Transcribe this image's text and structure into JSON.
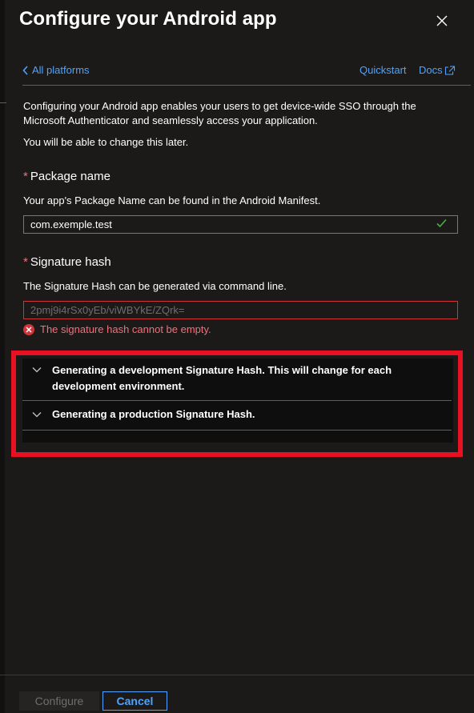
{
  "header": {
    "title": "Configure your Android app"
  },
  "nav": {
    "back_label": "All platforms",
    "quickstart_label": "Quickstart",
    "docs_label": "Docs"
  },
  "intro": {
    "line1": "Configuring your Android app enables your users to get device-wide SSO through the Microsoft Authenticator and seamlessly access your application.",
    "line2": "You will be able to change this later."
  },
  "package": {
    "required_mark": "*",
    "label": "Package name",
    "help": "Your app's Package Name can be found in the Android Manifest.",
    "value": "com.exemple.test"
  },
  "signature": {
    "required_mark": "*",
    "label": "Signature hash",
    "help": "The Signature Hash can be generated via command line.",
    "placeholder": "2pmj9i4rSx0yEb/viWBYkE/ZQrk=",
    "error": "The signature hash cannot be empty."
  },
  "accordion": {
    "items": [
      {
        "label": "Generating a development Signature Hash. This will change for each development environment."
      },
      {
        "label": "Generating a production Signature Hash."
      }
    ]
  },
  "footer": {
    "configure_label": "Configure",
    "cancel_label": "Cancel"
  },
  "colors": {
    "accent_link": "#4fa3ff",
    "error": "#d13438",
    "highlight": "#e81123",
    "focus_border": "#8764b8",
    "success_check": "#57a64a"
  },
  "icons": {
    "close": "close-icon",
    "back": "chevron-left-icon",
    "docs": "external-link-icon",
    "valid": "checkmark-icon",
    "error": "error-circle-icon",
    "accordion": "chevron-down-icon"
  }
}
